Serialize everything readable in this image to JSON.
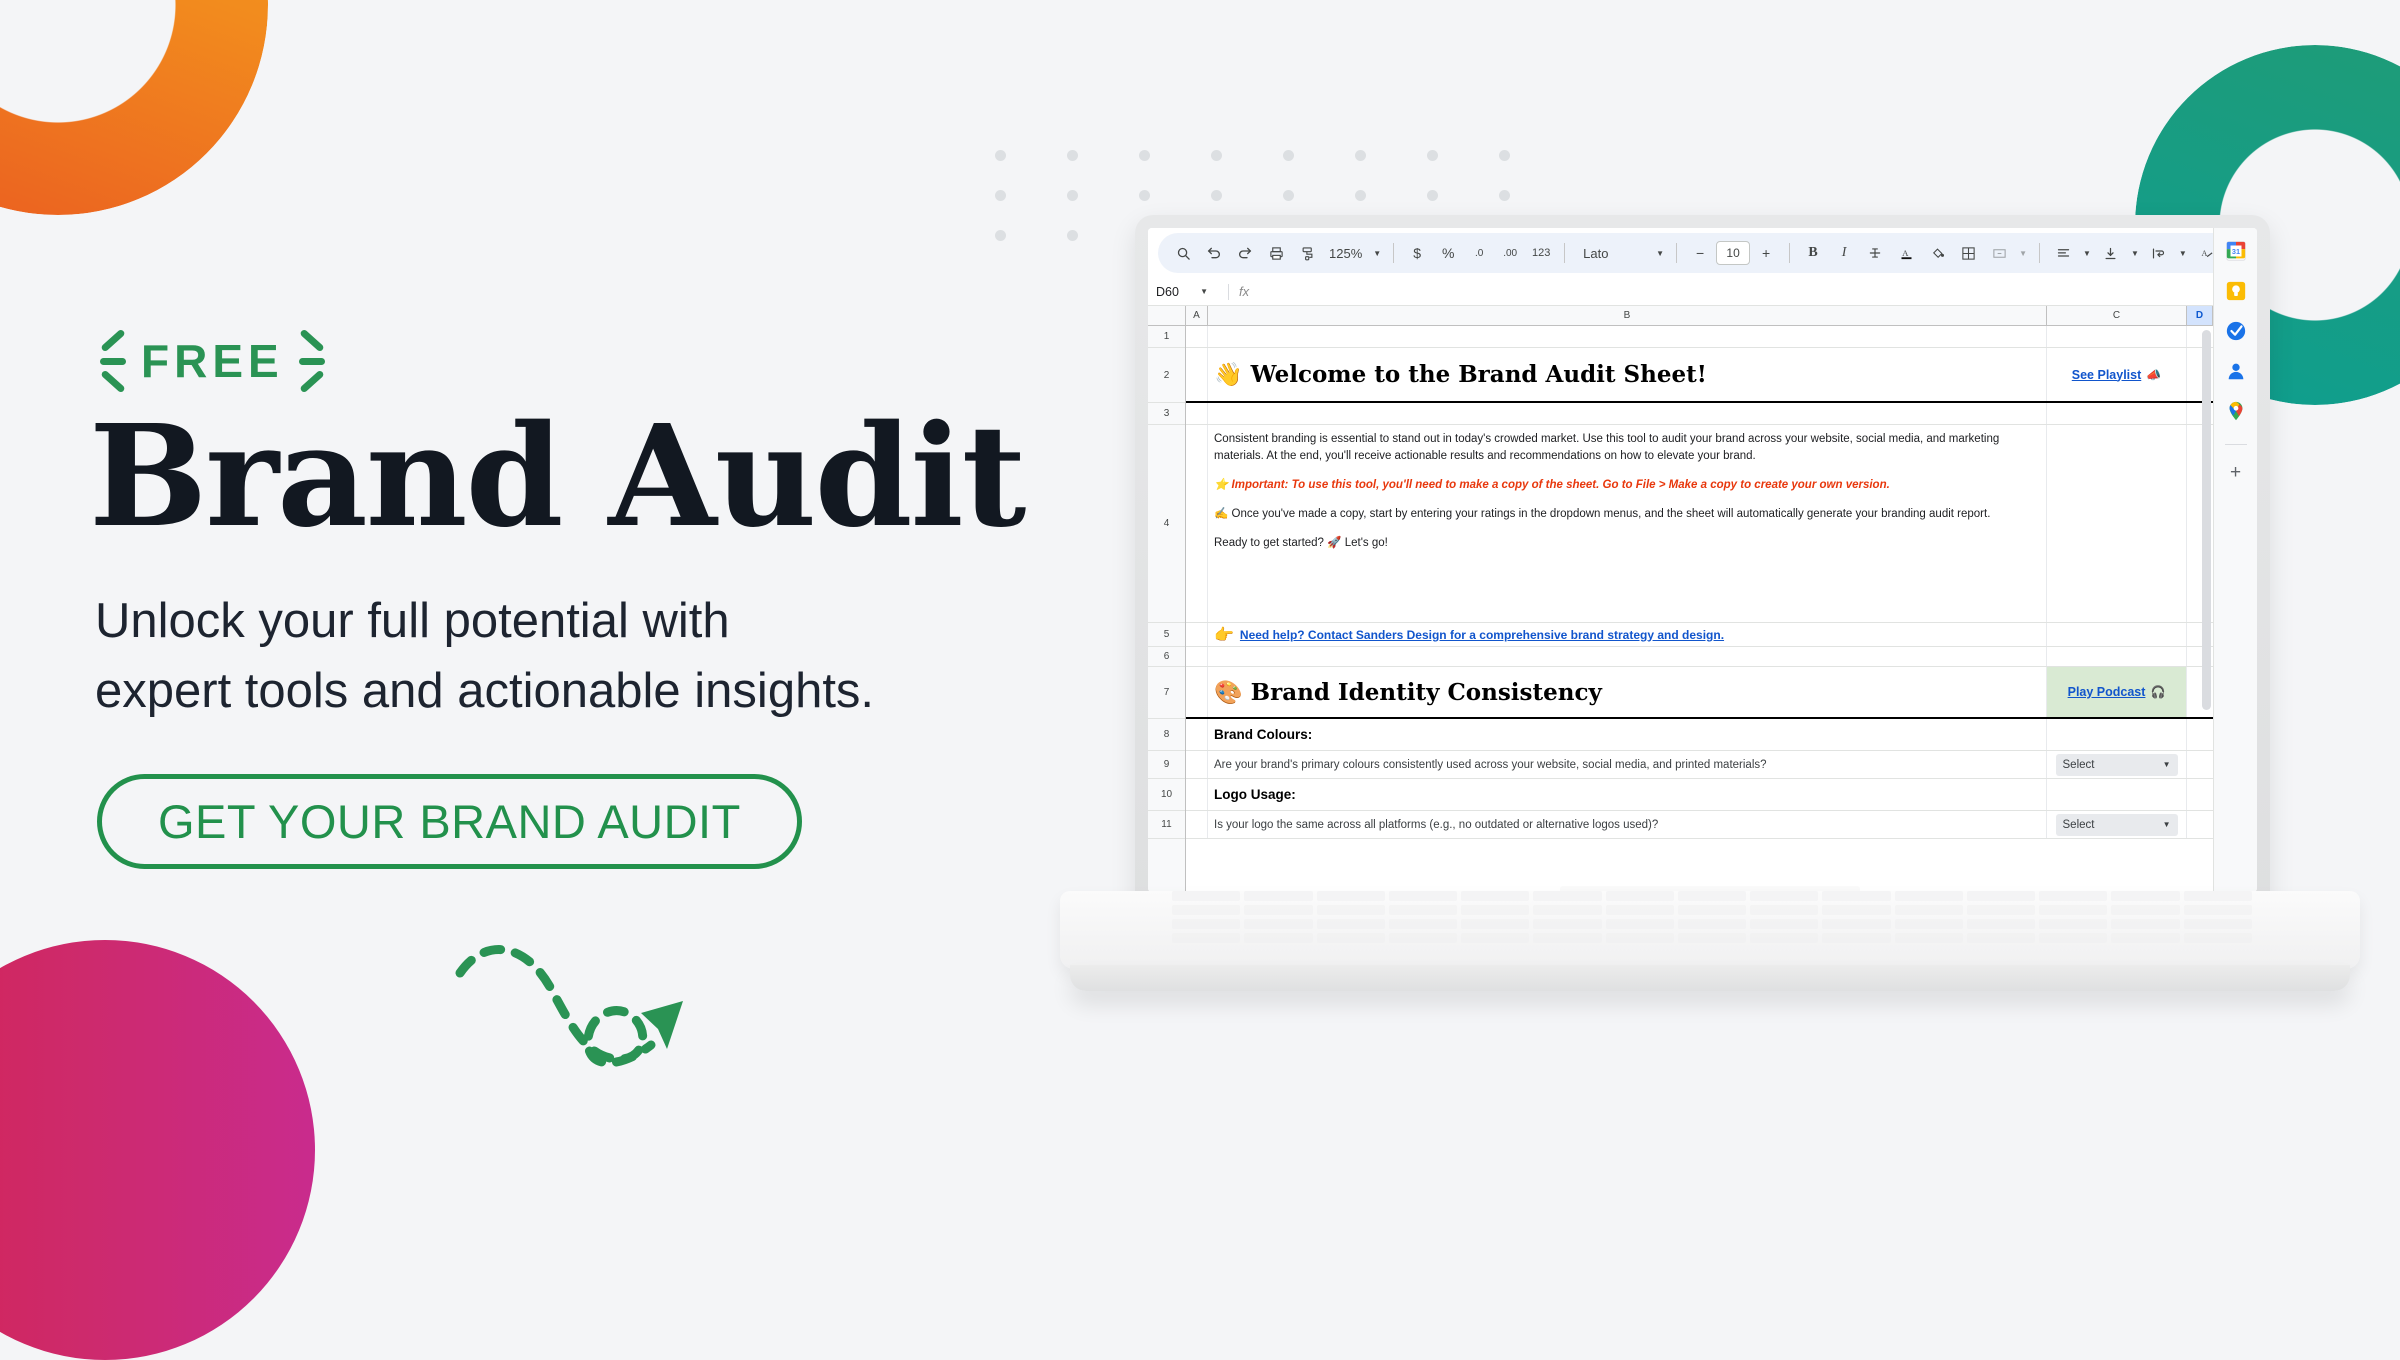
{
  "theme": {
    "background": "#f4f5f7",
    "green": "#22914c",
    "orange_gradient": [
      "#f7a01b",
      "#ea5c21"
    ],
    "green_gradient": [
      "#1f9b76",
      "#0e9e8f"
    ],
    "pink_gradient": [
      "#d32456",
      "#c92b8d"
    ],
    "headline_color": "#121821",
    "link_blue": "#1155cc",
    "alert_red": "#e8380d"
  },
  "promo": {
    "eyebrow": "FREE",
    "headline": "Brand Audit",
    "subhead_line1": "Unlock your full potential with",
    "subhead_line2": "expert tools and actionable insights.",
    "cta_label": "GET YOUR BRAND AUDIT"
  },
  "sheet": {
    "toolbar": {
      "zoom": "125%",
      "font": "Lato",
      "font_size": "10",
      "number_format_label": "123",
      "currency_symbol": "$",
      "percent_symbol": "%",
      "decimal_decrease": ".0",
      "decimal_increase": ".00",
      "bold": "B",
      "italic": "I",
      "minus": "−",
      "plus": "+",
      "more_label": "⋮",
      "collapse_label": "⌃"
    },
    "formula_bar": {
      "name_box": "D60",
      "fx_label": "fx",
      "value": ""
    },
    "columns": [
      "A",
      "B",
      "C",
      "D"
    ],
    "selected_column": "D",
    "row_numbers": [
      "1",
      "2",
      "3",
      "4",
      "5",
      "6",
      "7",
      "8",
      "9",
      "10",
      "11"
    ],
    "content": {
      "welcome_title": "Welcome to the Brand Audit Sheet!",
      "welcome_emoji": "👋",
      "see_playlist": "See Playlist",
      "see_playlist_emoji": "📣",
      "intro_paragraph": "Consistent branding is essential to stand out in today's crowded market. Use this tool to audit your brand across your website, social media, and marketing materials. At the end, you'll receive actionable results and recommendations on how to elevate your brand.",
      "important_emoji": "⭐",
      "important_prefix": "Important: To use this tool, you'll need to make a copy of the sheet. Go to ",
      "important_bold": "File > Make a copy",
      "important_suffix": " to create your own version.",
      "copy_emoji": "✍️",
      "copy_paragraph": "Once you've made a copy, start by entering your ratings in the dropdown menus, and the sheet will automatically generate your branding audit report.",
      "ready_text": "Ready to get started?",
      "ready_emoji": "🚀",
      "ready_suffix": "Let's go!",
      "help_emoji": "👉",
      "help_link": "Need help? Contact Sanders Design for a comprehensive brand strategy and design.",
      "section_emoji": "🎨",
      "section_title": "Brand Identity Consistency",
      "play_podcast": "Play Podcast",
      "play_podcast_emoji": "🎧",
      "q1_label": "Brand Colours:",
      "q1_text": "Are your brand's primary colours consistently used across your website, social media, and printed materials?",
      "q1_select": "Select",
      "q2_label": "Logo Usage:",
      "q2_text": "Is your logo the same across all platforms (e.g., no outdated or alternative logos used)?",
      "q2_select": "Select"
    },
    "side_panel_icons": [
      "google-calendar-icon",
      "google-keep-icon",
      "google-tasks-icon",
      "google-contacts-icon",
      "google-maps-icon",
      "add-app-icon"
    ]
  }
}
